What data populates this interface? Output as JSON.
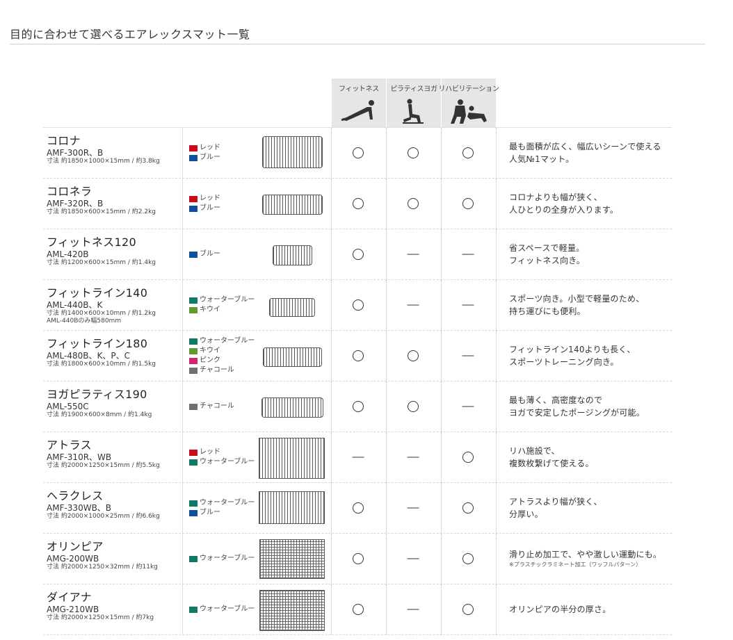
{
  "page": {
    "title": "目的に合わせて選べるエアレックスマット一覧"
  },
  "columns": {
    "uses": [
      {
        "label": "フィットネス",
        "icon": "pushup-figure-icon"
      },
      {
        "label": "ピラティスヨガ",
        "icon": "yoga-pose-figure-icon"
      },
      {
        "label": "リハビリテーション",
        "icon": "rehab-assist-figure-icon"
      }
    ]
  },
  "colors": {
    "red": "#cc0a1a",
    "blue": "#0f4f9c",
    "water_blue": "#117a66",
    "kiwi": "#5e9a2d",
    "pink": "#d0266f",
    "charcoal": "#707070"
  },
  "products": [
    {
      "name": "コロナ",
      "model": "AMF-300R、B",
      "size": "寸法 約1850×1000×15mm / 約3.8kg",
      "size2": "",
      "colors": [
        {
          "label": "レッド",
          "swatch": "red"
        },
        {
          "label": "ブルー",
          "swatch": "blue"
        }
      ],
      "mat": "lines",
      "use": [
        "circle",
        "circle",
        "circle"
      ],
      "desc": [
        "最も面積が広く、幅広いシーンで使える",
        "人気№1マット。"
      ],
      "note": ""
    },
    {
      "name": "コロネラ",
      "model": "AMF-320R、B",
      "size": "寸法 約1850×600×15mm / 約2.2kg",
      "size2": "",
      "colors": [
        {
          "label": "レッド",
          "swatch": "red"
        },
        {
          "label": "ブルー",
          "swatch": "blue"
        }
      ],
      "mat": "lines",
      "use": [
        "circle",
        "circle",
        "circle"
      ],
      "desc": [
        "コロナよりも幅が狭く、",
        "人ひとりの全身が入ります。"
      ],
      "note": ""
    },
    {
      "name": "フィットネス120",
      "model": "AML-420B",
      "size": "寸法 約1200×600×15mm / 約1.4kg",
      "size2": "",
      "colors": [
        {
          "label": "ブルー",
          "swatch": "blue"
        }
      ],
      "mat": "lines",
      "use": [
        "circle",
        "dash",
        "dash"
      ],
      "desc": [
        "省スペースで軽量。",
        "フィットネス向き。"
      ],
      "note": ""
    },
    {
      "name": "フィットライン140",
      "model": "AML-440B、K",
      "size": "寸法 約1400×600×10mm / 約1.2kg",
      "size2": "AML-440Bのみ幅580mm",
      "colors": [
        {
          "label": "ウォーターブルー",
          "swatch": "water_blue"
        },
        {
          "label": "キウイ",
          "swatch": "kiwi"
        }
      ],
      "mat": "lines",
      "use": [
        "circle",
        "dash",
        "dash"
      ],
      "desc": [
        "スポーツ向き。小型で軽量のため、",
        "持ち運びにも便利。"
      ],
      "note": ""
    },
    {
      "name": "フィットライン180",
      "model": "AML-480B、K、P、C",
      "size": "寸法 約1800×600×10mm / 約1.5kg",
      "size2": "",
      "colors": [
        {
          "label": "ウォーターブルー",
          "swatch": "water_blue"
        },
        {
          "label": "キウイ",
          "swatch": "kiwi"
        },
        {
          "label": "ピンク",
          "swatch": "pink"
        },
        {
          "label": "チャコール",
          "swatch": "charcoal"
        }
      ],
      "mat": "lines",
      "use": [
        "circle",
        "circle",
        "dash"
      ],
      "desc": [
        "フィットライン140よりも長く、",
        "スポーツトレーニング向き。"
      ],
      "note": ""
    },
    {
      "name": "ヨガピラティス190",
      "model": "AML-550C",
      "size": "寸法 約1900×600×8mm / 約1.4kg",
      "size2": "",
      "colors": [
        {
          "label": "チャコール",
          "swatch": "charcoal"
        }
      ],
      "mat": "lines",
      "use": [
        "circle",
        "circle",
        "dash"
      ],
      "desc": [
        "最も薄く、高密度なので",
        "ヨガで安定したポージングが可能。"
      ],
      "note": ""
    },
    {
      "name": "アトラス",
      "model": "AMF-310R、WB",
      "size": "寸法 約2000×1250×15mm / 約5.5kg",
      "size2": "",
      "colors": [
        {
          "label": "レッド",
          "swatch": "red"
        },
        {
          "label": "ウォーターブルー",
          "swatch": "water_blue"
        }
      ],
      "mat": "lines",
      "use": [
        "dash",
        "dash",
        "circle"
      ],
      "desc": [
        "リハ施設で、",
        "複数枚繋げて使える。"
      ],
      "note": ""
    },
    {
      "name": "ヘラクレス",
      "model": "AMF-330WB、B",
      "size": "寸法 約2000×1000×25mm / 約6.6kg",
      "size2": "",
      "colors": [
        {
          "label": "ウォーターブルー",
          "swatch": "water_blue"
        },
        {
          "label": "ブルー",
          "swatch": "blue"
        }
      ],
      "mat": "lines",
      "use": [
        "circle",
        "dash",
        "circle"
      ],
      "desc": [
        "アトラスより幅が狭く、",
        "分厚い。"
      ],
      "note": ""
    },
    {
      "name": "オリンピア",
      "model": "AMG-200WB",
      "size": "寸法 約2000×1250×32mm / 約11kg",
      "size2": "",
      "colors": [
        {
          "label": "ウォーターブルー",
          "swatch": "water_blue"
        }
      ],
      "mat": "grid",
      "use": [
        "circle",
        "dash",
        "circle"
      ],
      "desc": [
        "滑り止め加工で、やや激しい運動にも。"
      ],
      "note": "※プラスチックラミネート加工（ワッフルパターン）"
    },
    {
      "name": "ダイアナ",
      "model": "AMG-210WB",
      "size": "寸法 約2000×1250×15mm / 約7kg",
      "size2": "",
      "colors": [
        {
          "label": "ウォーターブルー",
          "swatch": "water_blue"
        }
      ],
      "mat": "grid",
      "use": [
        "circle",
        "dash",
        "circle"
      ],
      "desc": [
        "オリンピアの半分の厚さ。"
      ],
      "note": ""
    }
  ]
}
